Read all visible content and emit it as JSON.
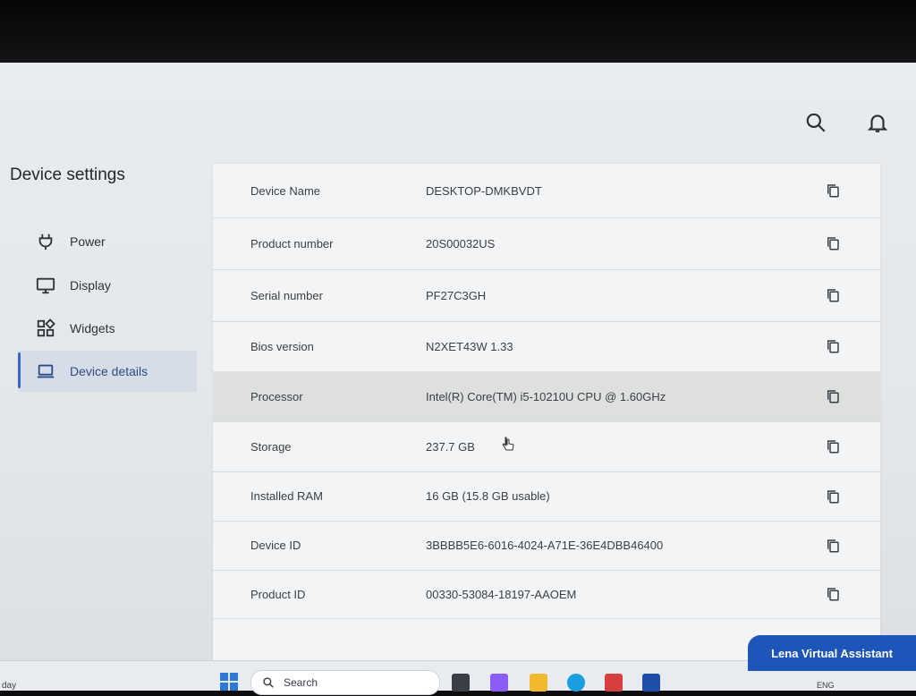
{
  "header": {
    "icons": [
      "search-icon",
      "bell-icon"
    ]
  },
  "sidebar": {
    "title": "Device settings",
    "items": [
      {
        "label": "Power",
        "icon": "power-plug-icon",
        "active": false
      },
      {
        "label": "Display",
        "icon": "monitor-icon",
        "active": false
      },
      {
        "label": "Widgets",
        "icon": "widgets-icon",
        "active": false
      },
      {
        "label": "Device details",
        "icon": "laptop-icon",
        "active": true
      }
    ]
  },
  "details": {
    "rows": [
      {
        "label": "Device Name",
        "value": "DESKTOP-DMKBVDT"
      },
      {
        "label": "Product number",
        "value": "20S00032US"
      },
      {
        "label": "Serial number",
        "value": "PF27C3GH"
      },
      {
        "label": "Bios version",
        "value": "N2XET43W 1.33"
      },
      {
        "label": "Processor",
        "value": "Intel(R) Core(TM) i5-10210U CPU @ 1.60GHz"
      },
      {
        "label": "Storage",
        "value": "237.7 GB"
      },
      {
        "label": "Installed RAM",
        "value": "16 GB (15.8 GB usable)"
      },
      {
        "label": "Device ID",
        "value": "3BBBB5E6-6016-4024-A71E-36E4DBB46400"
      },
      {
        "label": "Product ID",
        "value": "00330-53084-18197-AAOEM"
      }
    ]
  },
  "assistant": {
    "label": "Lena Virtual Assistant",
    "color": "#1d56b8"
  },
  "taskbar": {
    "left_text": "day",
    "search_placeholder": "Search",
    "lang": "ENG"
  },
  "colors": {
    "accent": "#3b66c3",
    "active_bg": "#d7dde6"
  }
}
